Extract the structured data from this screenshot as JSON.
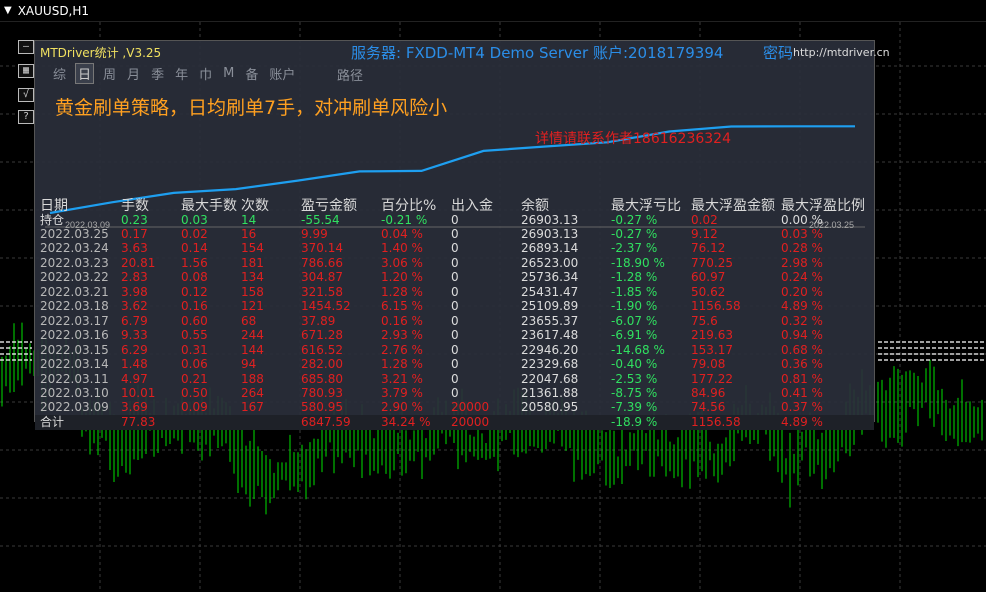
{
  "chart": {
    "symbol": "XAUUSD,H1",
    "colors": {
      "bull": "#00e000",
      "bear": "#00e000",
      "grid": "#3a3a3a",
      "bg": "#000000",
      "lines": "#ffffff"
    }
  },
  "tools": [
    {
      "icon": "minimize-icon",
      "glyph": "—"
    },
    {
      "icon": "grid-icon",
      "glyph": "▦"
    },
    {
      "icon": "chart-icon",
      "glyph": "√"
    },
    {
      "icon": "help-icon",
      "glyph": "?"
    }
  ],
  "panel": {
    "title": "MTDriver统计 ,V3.25",
    "server": "服务器:  FXDD-MT4 Demo Server 账户:2018179394",
    "password_label": "密码",
    "url": "http://mtdriver.cn",
    "tabs": [
      "综",
      "日",
      "周",
      "月",
      "季",
      "年",
      "巾",
      "M",
      "备",
      "账户"
    ],
    "active_tab": 1,
    "path": "路径",
    "strategy_title": "黄金刷单策略，日均刷单7手，对冲刷单风险小",
    "contact": "详情请联系作者18616236324",
    "equity": {
      "start_label": "2022.03.09",
      "end_label": "2022.03.25",
      "values": [
        20580.95,
        21361.88,
        22047.68,
        22329.68,
        22946.2,
        23617.48,
        23655.37,
        25109.89,
        25431.47,
        25736.34,
        26523.0,
        26893.14,
        26903.13,
        26903.13
      ]
    }
  },
  "table": {
    "headers": [
      "日期",
      "手数",
      "最大手数",
      "次数",
      "盈亏金额",
      "百分比%",
      "出入金",
      "余额",
      "最大浮亏比",
      "最大浮盈金额",
      "最大浮盈比例"
    ],
    "holding": [
      "持仓",
      "0.23",
      "0.03",
      "14",
      "-55.54",
      "-0.21 %",
      "0",
      "26903.13",
      "-0.27 %",
      "0.02",
      "0.00 %"
    ],
    "rows": [
      [
        "2022.03.25",
        "0.17",
        "0.02",
        "16",
        "9.99",
        "0.04 %",
        "0",
        "26903.13",
        "-0.27 %",
        "9.12",
        "0.03 %"
      ],
      [
        "2022.03.24",
        "3.63",
        "0.14",
        "154",
        "370.14",
        "1.40 %",
        "0",
        "26893.14",
        "-2.37 %",
        "76.12",
        "0.28 %"
      ],
      [
        "2022.03.23",
        "20.81",
        "1.56",
        "181",
        "786.66",
        "3.06 %",
        "0",
        "26523.00",
        "-18.90 %",
        "770.25",
        "2.98 %"
      ],
      [
        "2022.03.22",
        "2.83",
        "0.08",
        "134",
        "304.87",
        "1.20 %",
        "0",
        "25736.34",
        "-1.28 %",
        "60.97",
        "0.24 %"
      ],
      [
        "2022.03.21",
        "3.98",
        "0.12",
        "158",
        "321.58",
        "1.28 %",
        "0",
        "25431.47",
        "-1.85 %",
        "50.62",
        "0.20 %"
      ],
      [
        "2022.03.18",
        "3.62",
        "0.16",
        "121",
        "1454.52",
        "6.15 %",
        "0",
        "25109.89",
        "-1.90 %",
        "1156.58",
        "4.89 %"
      ],
      [
        "2022.03.17",
        "6.79",
        "0.60",
        "68",
        "37.89",
        "0.16 %",
        "0",
        "23655.37",
        "-6.07 %",
        "75.6",
        "0.32 %"
      ],
      [
        "2022.03.16",
        "9.33",
        "0.55",
        "244",
        "671.28",
        "2.93 %",
        "0",
        "23617.48",
        "-6.91 %",
        "219.63",
        "0.94 %"
      ],
      [
        "2022.03.15",
        "6.29",
        "0.31",
        "144",
        "616.52",
        "2.76 %",
        "0",
        "22946.20",
        "-14.68 %",
        "153.17",
        "0.68 %"
      ],
      [
        "2022.03.14",
        "1.48",
        "0.06",
        "94",
        "282.00",
        "1.28 %",
        "0",
        "22329.68",
        "-0.40 %",
        "79.08",
        "0.36 %"
      ],
      [
        "2022.03.11",
        "4.97",
        "0.21",
        "188",
        "685.80",
        "3.21 %",
        "0",
        "22047.68",
        "-2.53 %",
        "177.22",
        "0.81 %"
      ],
      [
        "2022.03.10",
        "10.01",
        "0.50",
        "264",
        "780.93",
        "3.79 %",
        "0",
        "21361.88",
        "-8.75 %",
        "84.96",
        "0.41 %"
      ],
      [
        "2022.03.09",
        "3.69",
        "0.09",
        "167",
        "580.95",
        "2.90 %",
        "20000",
        "20580.95",
        "-7.39 %",
        "74.56",
        "0.37 %"
      ]
    ],
    "total": [
      "合计",
      "77.83",
      "",
      "",
      "6847.59",
      "34.24 %",
      "20000",
      "",
      "-18.9 %",
      "1156.58",
      "4.89 %"
    ]
  }
}
